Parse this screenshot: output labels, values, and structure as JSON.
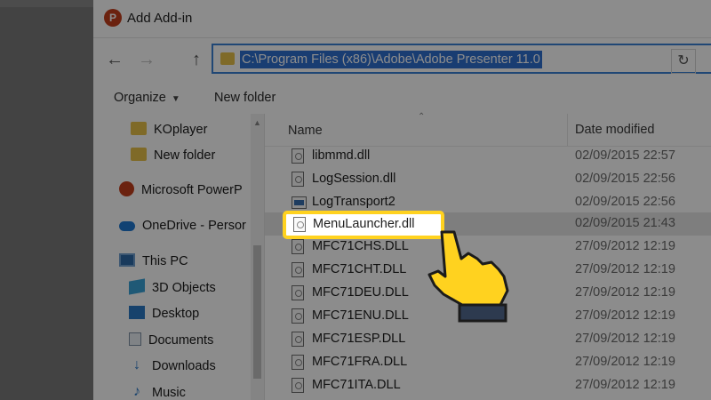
{
  "dialog": {
    "title": "Add Add-in",
    "app_icon": "P"
  },
  "nav": {
    "back": "←",
    "forward": "→",
    "up": "↑",
    "refresh": "↻",
    "address": "C:\\Program Files (x86)\\Adobe\\Adobe Presenter 11.0"
  },
  "toolbar": {
    "organize": "Organize",
    "new_folder": "New folder"
  },
  "sidebar": {
    "items": [
      {
        "label": "KOplayer",
        "icon": "folder-icon"
      },
      {
        "label": "New folder",
        "icon": "folder-icon"
      },
      {
        "label": "Microsoft PowerP",
        "icon": "powerpoint-icon"
      },
      {
        "label": "OneDrive - Persor",
        "icon": "onedrive-icon"
      },
      {
        "label": "This PC",
        "icon": "computer-icon"
      },
      {
        "label": "3D Objects",
        "icon": "3d-objects-icon"
      },
      {
        "label": "Desktop",
        "icon": "desktop-icon"
      },
      {
        "label": "Documents",
        "icon": "documents-icon"
      },
      {
        "label": "Downloads",
        "icon": "downloads-icon"
      },
      {
        "label": "Music",
        "icon": "music-icon"
      }
    ]
  },
  "columns": {
    "name": "Name",
    "date": "Date modified"
  },
  "files": [
    {
      "name": "libmmd.dll",
      "date": "02/09/2015 22:57",
      "type": "dll"
    },
    {
      "name": "LogSession.dll",
      "date": "02/09/2015 22:56",
      "type": "dll"
    },
    {
      "name": "LogTransport2",
      "date": "02/09/2015 22:56",
      "type": "exe"
    },
    {
      "name": "MenuLauncher.dll",
      "date": "02/09/2015 21:43",
      "type": "dll"
    },
    {
      "name": "MFC71CHS.DLL",
      "date": "27/09/2012 12:19",
      "type": "dll"
    },
    {
      "name": "MFC71CHT.DLL",
      "date": "27/09/2012 12:19",
      "type": "dll"
    },
    {
      "name": "MFC71DEU.DLL",
      "date": "27/09/2012 12:19",
      "type": "dll"
    },
    {
      "name": "MFC71ENU.DLL",
      "date": "27/09/2012 12:19",
      "type": "dll"
    },
    {
      "name": "MFC71ESP.DLL",
      "date": "27/09/2012 12:19",
      "type": "dll"
    },
    {
      "name": "MFC71FRA.DLL",
      "date": "27/09/2012 12:19",
      "type": "dll"
    },
    {
      "name": "MFC71ITA.DLL",
      "date": "27/09/2012 12:19",
      "type": "dll"
    }
  ],
  "highlight": {
    "file": "MenuLauncher.dll",
    "color": "#ffd21f"
  }
}
